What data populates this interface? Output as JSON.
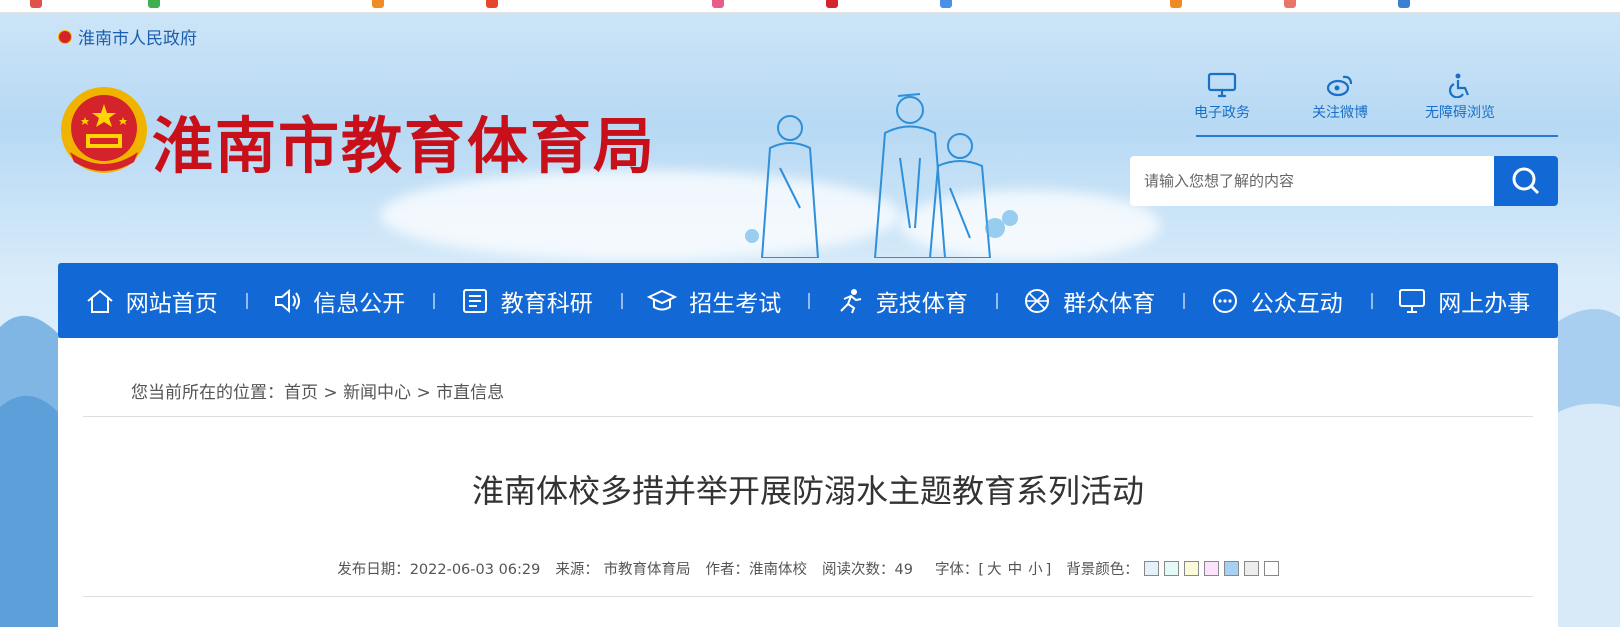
{
  "header": {
    "city_link": "淮南市人民政府",
    "site_title": "淮南市教育体育局",
    "quick_links": [
      {
        "label": "电子政务",
        "icon": "monitor-icon"
      },
      {
        "label": "关注微博",
        "icon": "weibo-icon"
      },
      {
        "label": "无障碍浏览",
        "icon": "accessibility-icon"
      }
    ],
    "search": {
      "placeholder": "请输入您想了解的内容",
      "icon": "search-icon"
    }
  },
  "nav": [
    {
      "label": "网站首页",
      "icon": "home-icon"
    },
    {
      "label": "信息公开",
      "icon": "speaker-icon"
    },
    {
      "label": "教育科研",
      "icon": "document-icon"
    },
    {
      "label": "招生考试",
      "icon": "graduation-cap-icon"
    },
    {
      "label": "竞技体育",
      "icon": "runner-icon"
    },
    {
      "label": "群众体育",
      "icon": "ball-icon"
    },
    {
      "label": "公众互动",
      "icon": "chat-icon"
    },
    {
      "label": "网上办事",
      "icon": "monitor-icon"
    }
  ],
  "breadcrumb": {
    "prefix": "您当前所在的位置：",
    "items": [
      "首页",
      "新闻中心",
      "市直信息"
    ],
    "sep": ">"
  },
  "article": {
    "title": "淮南体校多措并举开展防溺水主题教育系列活动",
    "meta": {
      "date": "发布日期：2022-06-03 06:29",
      "source": "来源： 市教育体育局",
      "author": "作者：淮南体校",
      "views": "阅读次数：49",
      "font_label": "字体：[",
      "font_sizes": [
        "大",
        "中",
        "小"
      ],
      "font_close": "]",
      "bg_label": "背景颜色："
    },
    "bg_colors": [
      "#e3f2fb",
      "#e3faf7",
      "#fbfbd9",
      "#fbe3fb",
      "#a8d0f5",
      "#ededed",
      "#ffffff"
    ]
  },
  "colors": {
    "nav_bg": "#1268d4",
    "title_red": "#c8101b",
    "accent": "#1a6fc6"
  }
}
